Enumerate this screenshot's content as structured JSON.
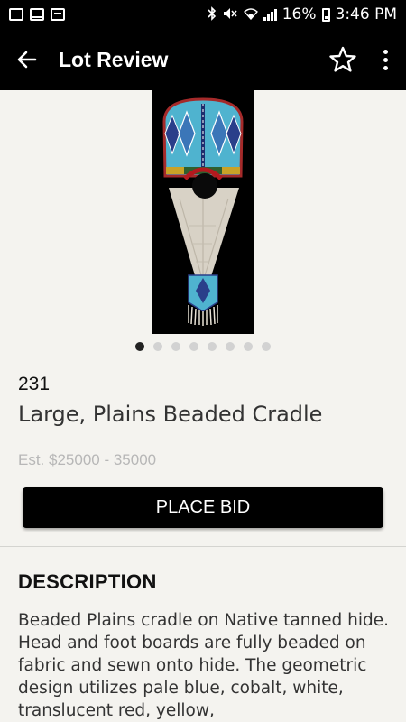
{
  "status_bar": {
    "battery_percent": "16%",
    "time": "3:46 PM",
    "left_icons": [
      "gallery-icon",
      "mail-icon",
      "calendar-icon"
    ],
    "right_icons": [
      "bluetooth-icon",
      "mute-icon",
      "wifi-icon",
      "signal-icon",
      "battery-icon"
    ]
  },
  "app_bar": {
    "title": "Lot Review",
    "back_icon": "arrow-left-icon",
    "favorite_icon": "star-outline-icon",
    "menu_icon": "more-vert-icon"
  },
  "gallery": {
    "image_count": 8,
    "active_index": 0
  },
  "lot": {
    "number": "231",
    "title": "Large, Plains Beaded Cradle",
    "estimate": "Est. $25000 - 35000"
  },
  "bid_button": {
    "label": "PLACE BID"
  },
  "description": {
    "heading": "DESCRIPTION",
    "body": "Beaded Plains cradle on Native tanned hide. Head and foot boards are fully beaded on fabric and sewn onto hide. The geometric design utilizes pale blue, cobalt, white, translucent red, yellow,"
  },
  "colors": {
    "app_bar": "#000000",
    "background": "#f4f3ef",
    "estimate_text": "#b7b7b7",
    "pager_active": "#222222",
    "pager_inactive": "#d2d2d2"
  }
}
